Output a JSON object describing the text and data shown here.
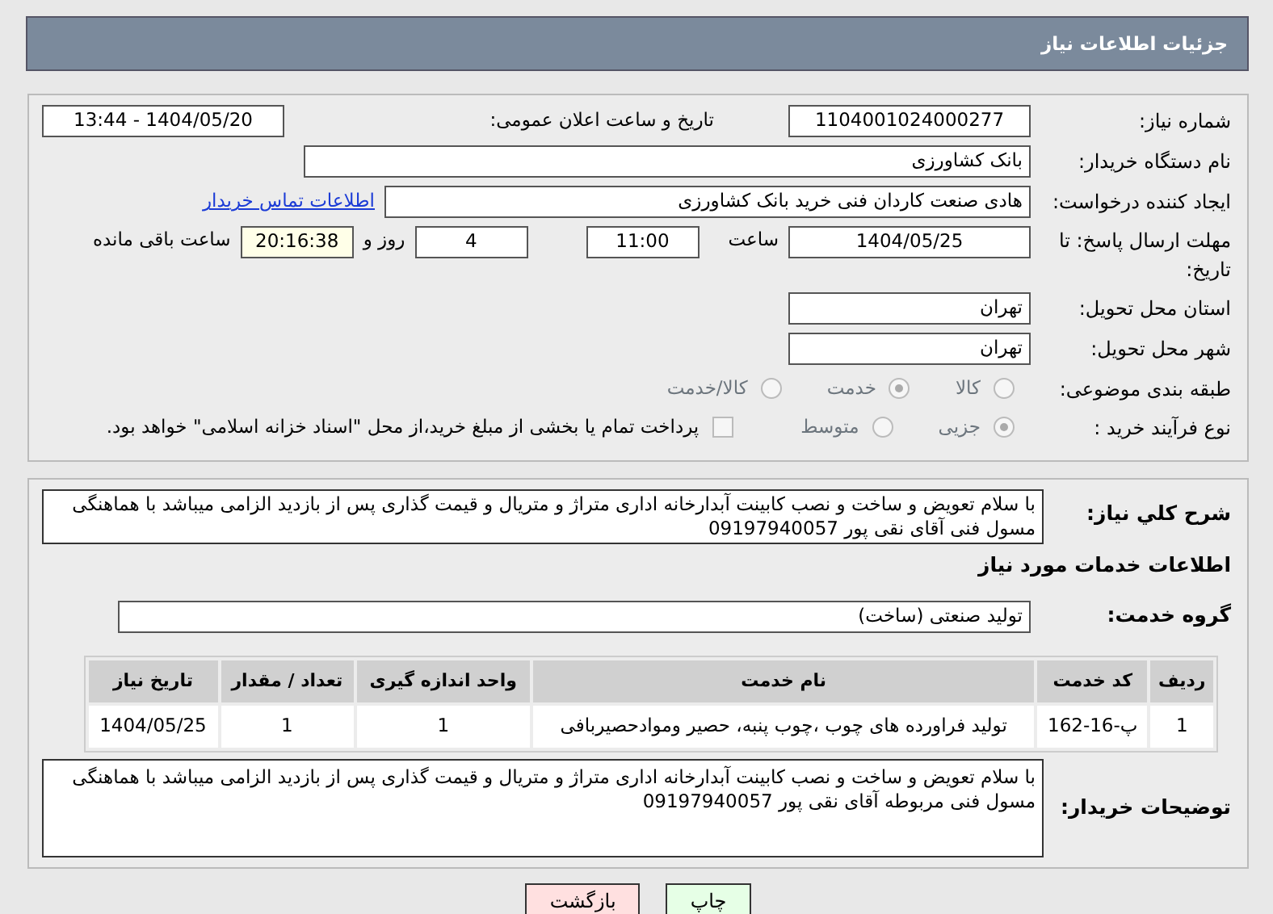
{
  "header": {
    "title": "جزئیات اطلاعات نیاز"
  },
  "details": {
    "need_number": {
      "label": "شماره نیاز:",
      "value": "1104001024000277"
    },
    "announce": {
      "label": "تاریخ و ساعت اعلان عمومی:",
      "value": "1404/05/20 - 13:44"
    },
    "buyer_org": {
      "label": "نام دستگاه خریدار:",
      "value": "بانک کشاورزی"
    },
    "requester": {
      "label": "ایجاد کننده درخواست:",
      "value": "هادی صنعت کاردان فنی خرید بانک کشاورزی",
      "link": "اطلاعات تماس خریدار"
    },
    "deadline": {
      "label": "مهلت ارسال پاسخ: تا تاریخ:",
      "date": "1404/05/25",
      "time_label": "ساعت",
      "time": "11:00",
      "days": "4",
      "days_label": "روز و",
      "remaining": "20:16:38",
      "remaining_label": "ساعت باقی مانده"
    },
    "province": {
      "label": "استان محل تحویل:",
      "value": "تهران"
    },
    "city": {
      "label": "شهر محل تحویل:",
      "value": "تهران"
    },
    "category": {
      "label": "طبقه بندی موضوعی:",
      "options": [
        {
          "label": "کالا",
          "selected": false
        },
        {
          "label": "خدمت",
          "selected": true
        },
        {
          "label": "کالا/خدمت",
          "selected": false
        }
      ]
    },
    "process": {
      "label": "نوع فرآیند خرید :",
      "options": [
        {
          "label": "جزیی",
          "selected": true
        },
        {
          "label": "متوسط",
          "selected": false
        }
      ],
      "payment": {
        "label": "پرداخت تمام یا بخشی از مبلغ خرید،از محل \"اسناد خزانه اسلامی\" خواهد بود.",
        "checked": false
      }
    }
  },
  "services": {
    "summary": {
      "label": "شرح کلي نياز:",
      "value": "با سلام تعویض و ساخت و نصب کابینت آبدارخانه اداری متراژ و متریال و قیمت گذاری پس از بازدید الزامی میباشد با هماهنگی مسول فنی آقای نقی پور 09197940057"
    },
    "section_title": "اطلاعات خدمات مورد نیاز",
    "group": {
      "label": "گروه خدمت:",
      "value": "تولید صنعتی (ساخت)"
    },
    "table": {
      "columns": [
        "ردیف",
        "کد خدمت",
        "نام خدمت",
        "واحد اندازه گیری",
        "تعداد / مقدار",
        "تاریخ نیاز"
      ],
      "rows": [
        [
          "1",
          "پ-16-162",
          "تولید فراورده های چوب ،چوب پنبه، حصیر وموادحصیربافی",
          "1",
          "1",
          "1404/05/25"
        ]
      ]
    },
    "buyer_notes": {
      "label": "توضیحات خریدار:",
      "value": "با سلام تعویض و ساخت و نصب کابینت آبدارخانه اداری متراژ و متریال و قیمت گذاری پس از بازدید الزامی میباشد با هماهنگی مسول فنی مربوطه آقای نقی پور 09197940057"
    }
  },
  "buttons": [
    {
      "label": "چاپ",
      "kind": "print"
    },
    {
      "label": "بازگشت",
      "kind": "back"
    }
  ]
}
